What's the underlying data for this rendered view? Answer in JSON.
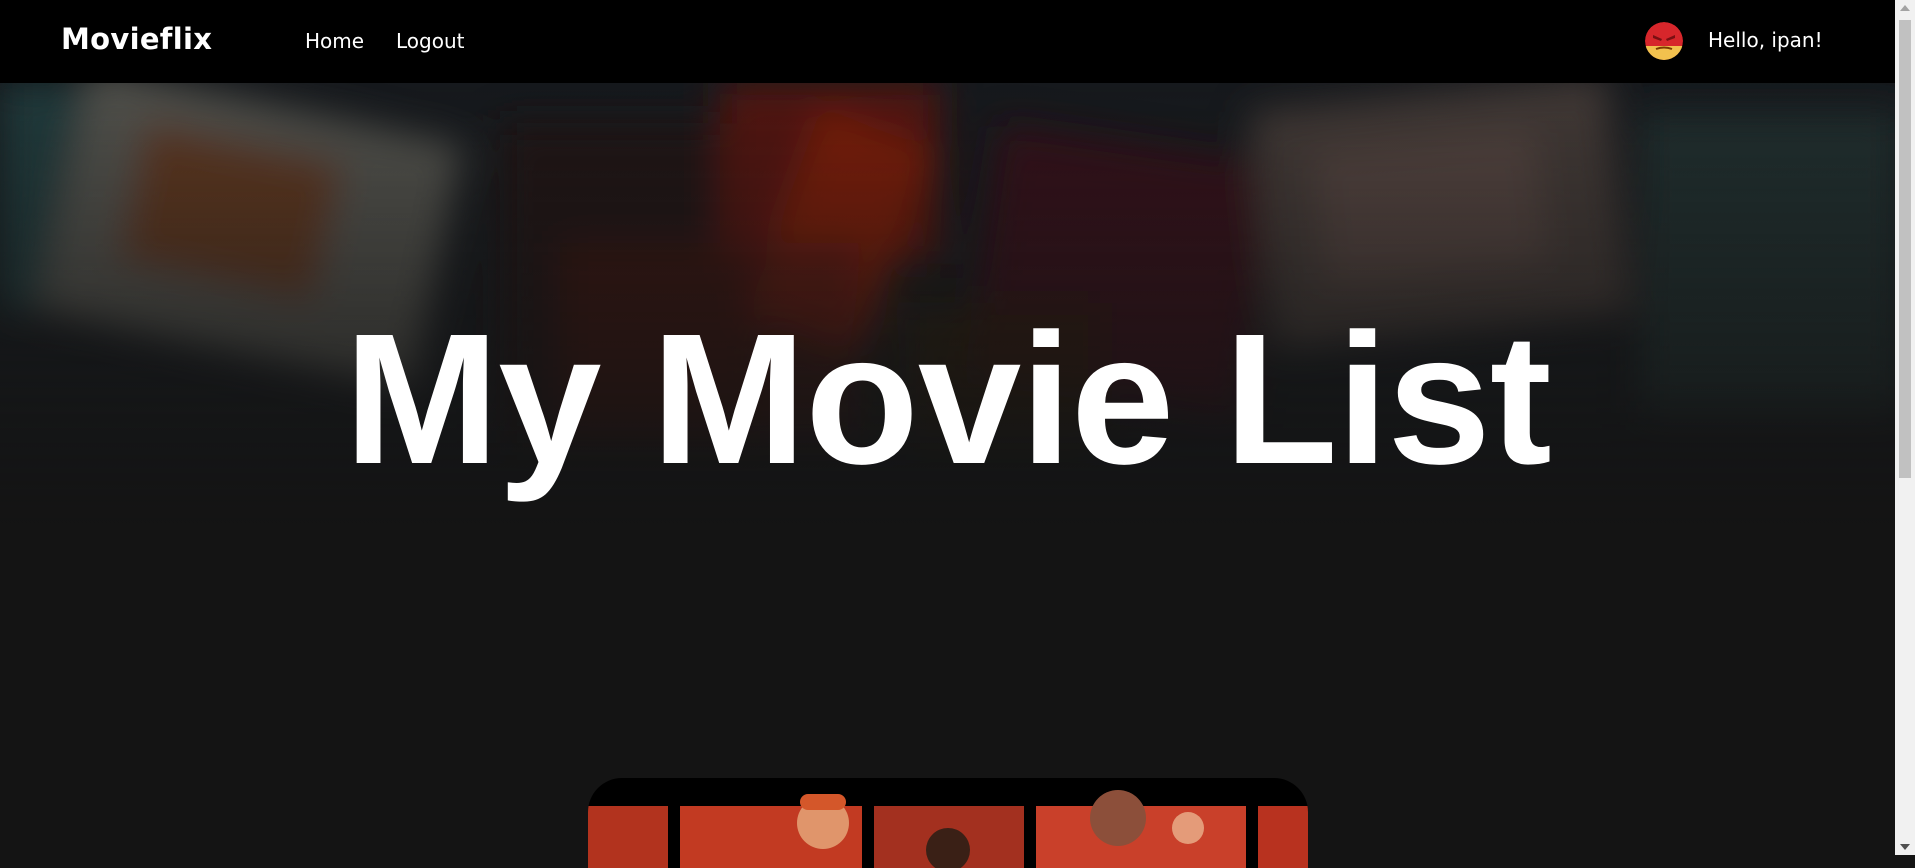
{
  "navbar": {
    "brand": "Movieflix",
    "links": [
      {
        "label": "Home"
      },
      {
        "label": "Logout"
      }
    ],
    "greeting": "Hello, ipan!",
    "avatar_icon": "angry-face-avatar-icon"
  },
  "hero": {
    "title": "My Movie List"
  },
  "colors": {
    "navbar_bg": "#000000",
    "page_bg": "#141414",
    "text": "#ffffff",
    "poster_accent": "#c8301e"
  },
  "scroll": {
    "scrolled_fraction": 0.0
  }
}
